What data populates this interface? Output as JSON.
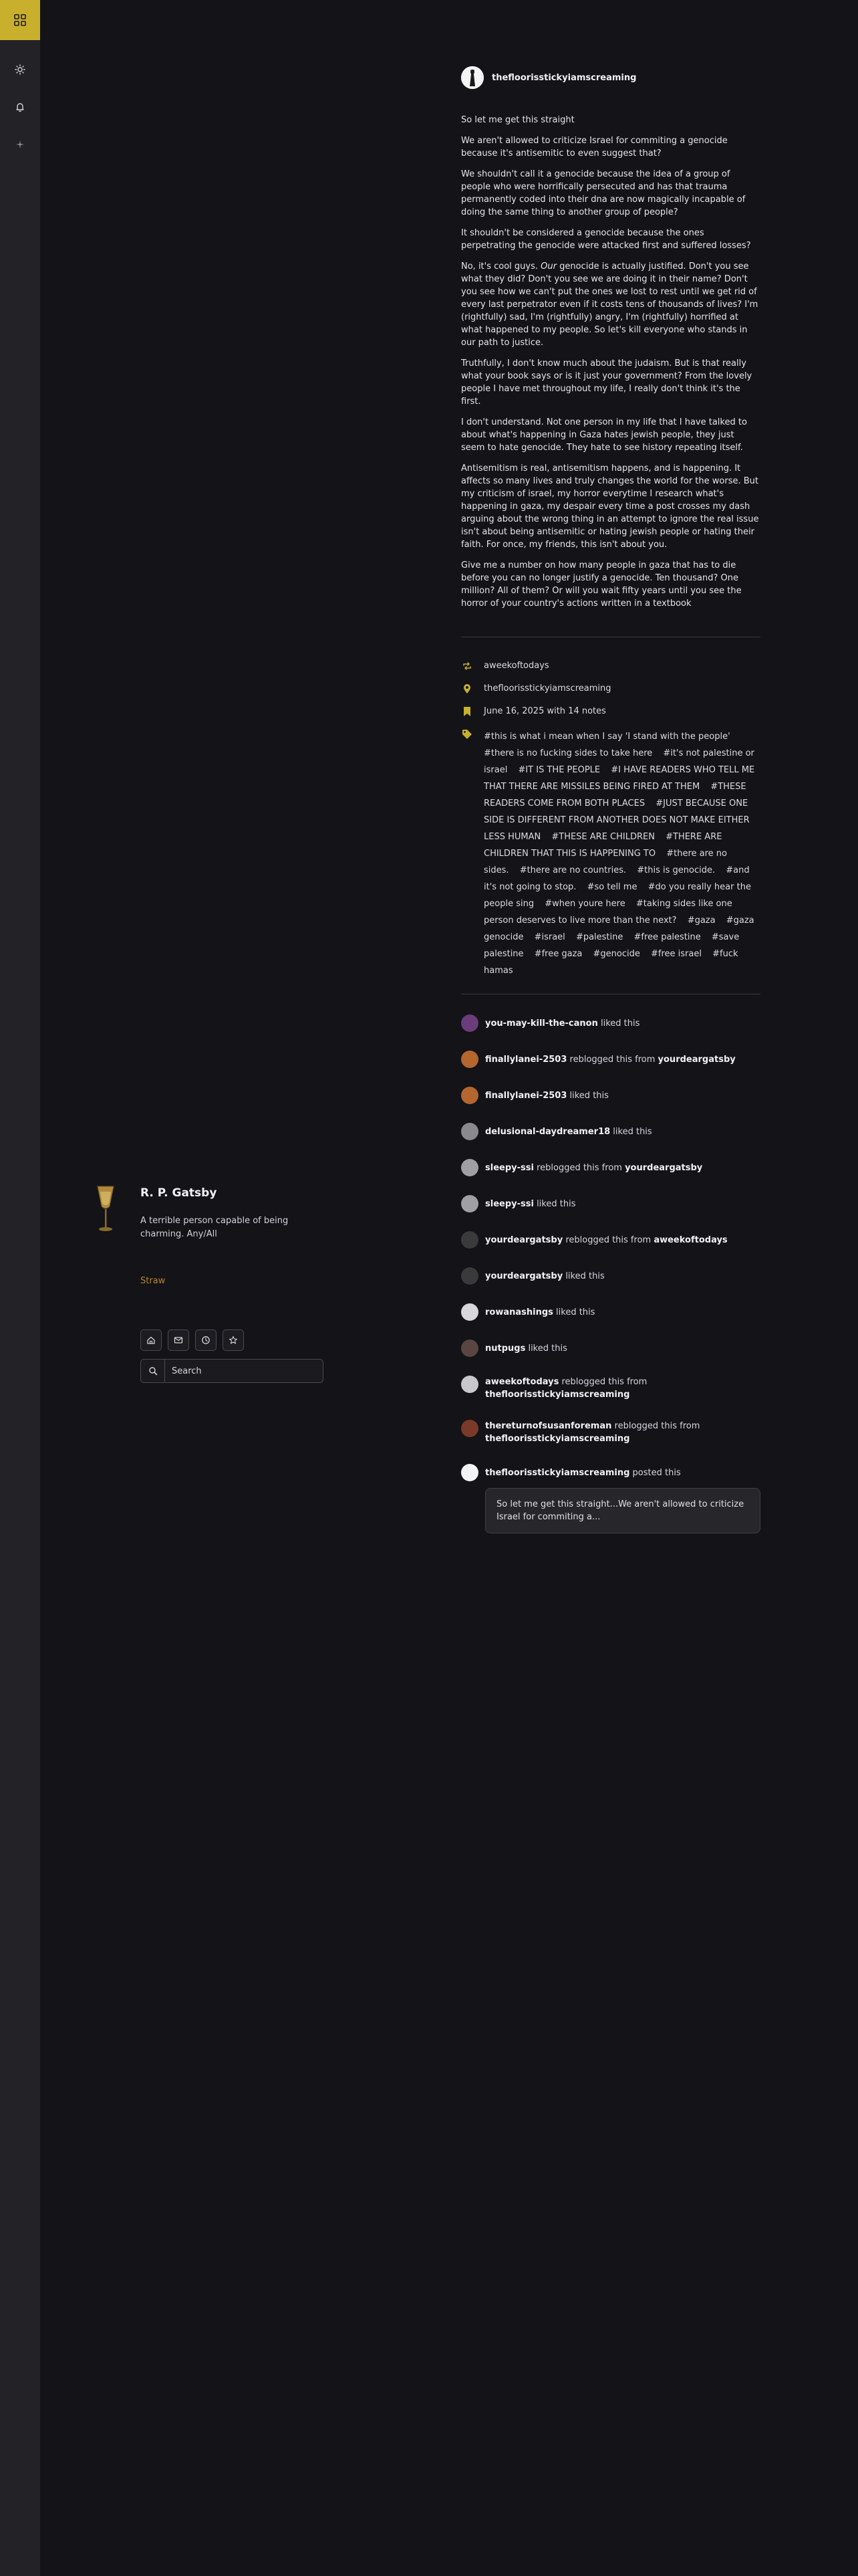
{
  "rail": {
    "items": [
      "grid-icon",
      "sun-icon",
      "bell-icon",
      "sparkle-icon"
    ],
    "accent": "#c9b02c"
  },
  "profile": {
    "name": "R. P. Gatsby",
    "description": "A terrible person capable of being charming. Any/All",
    "link": "Straw",
    "icons": [
      "home-icon",
      "mail-icon",
      "clock-icon",
      "star-icon"
    ],
    "search_placeholder": "Search"
  },
  "post": {
    "author": "thefloorisstickyiamscreaming",
    "paragraphs": [
      "So let me get this straight",
      "We aren't allowed to criticize Israel for commiting a genocide because it's antisemitic to even suggest that?",
      "We shouldn't call it a genocide because the idea of a group of people who were horrifically persecuted and has that trauma permanently coded into their dna are now magically incapable of doing the same thing to another group of people?",
      "It shouldn't be considered a genocide because the ones perpetrating the genocide were attacked first and suffered losses?",
      "No, it's cool guys. |Our| genocide is actually justified. Don't you see what they did? Don't you see we are doing it in their name? Don't you see how we can't put the ones we lost to rest until we get rid of every last perpetrator even if it costs tens of thousands of lives? I'm (rightfully) sad, I'm (rightfully) angry, I'm (rightfully) horrified at what happened to my people. So let's kill everyone who stands in our path to justice.",
      "Truthfully, I don't know much about the judaism. But is that really what your book says or is it just your government? From the lovely people I have met throughout my life, I really don't think it's the first.",
      "I don't understand. Not one person in my life that I have talked to about what's happening in Gaza hates jewish people, they just seem to hate genocide. They hate to see history repeating itself.",
      "Antisemitism is real, antisemitism happens, and is happening. It affects so many lives and truly changes the world for the worse. But my criticism of israel, my horror everytime I research what's happening in gaza, my despair every time a post crosses my dash arguing about the wrong thing in an attempt to ignore the real issue isn't about being antisemitic or hating jewish people or hating their faith. For once, my friends, this isn't about you.",
      "Give me a number on how many people in gaza that has to die before you can no longer justify a genocide. Ten thousand? One million? All of them? Or will you wait fifty years until you see the horror of your country's actions written in a textbook"
    ],
    "meta": {
      "reblogged_from": "aweekoftodays",
      "source": "thefloorisstickyiamscreaming",
      "date_notes": "June 16, 2025 with 14 notes"
    },
    "tags": [
      "#this is what i mean when I say 'I stand with the people'",
      "#there is no fucking sides to take here",
      "#it's not palestine or israel",
      "#IT IS THE PEOPLE",
      "#I HAVE READERS WHO TELL ME THAT THERE ARE MISSILES BEING FIRED AT THEM",
      "#THESE READERS COME FROM BOTH PLACES",
      "#JUST BECAUSE ONE SIDE IS DIFFERENT FROM ANOTHER DOES NOT MAKE EITHER LESS HUMAN",
      "#THESE ARE CHILDREN",
      "#THERE ARE CHILDREN THAT THIS IS HAPPENING TO",
      "#there are no sides.",
      "#there are no countries.",
      "#this is genocide.",
      "#and it's not going to stop.",
      "#so tell me",
      "#do you really hear the people sing",
      "#when youre here",
      "#taking sides like one person deserves to live more than the next?",
      "#gaza",
      "#gaza genocide",
      "#israel",
      "#palestine",
      "#free palestine",
      "#save palestine",
      "#free gaza",
      "#genocide",
      "#free israel",
      "#fuck hamas"
    ]
  },
  "notes": [
    {
      "user": "you-may-kill-the-canon",
      "action": "liked this",
      "from": "",
      "avatar_color": "#6a3d7a"
    },
    {
      "user": "finallylanei-2503",
      "action": "reblogged this from",
      "from": "yourdeargatsby",
      "avatar_color": "#b4662e"
    },
    {
      "user": "finallylanei-2503",
      "action": "liked this",
      "from": "",
      "avatar_color": "#b4662e"
    },
    {
      "user": "delusional-daydreamer18",
      "action": "liked this",
      "from": "",
      "avatar_color": "#8a8a8e"
    },
    {
      "user": "sleepy-ssi",
      "action": "reblogged this from",
      "from": "yourdeargatsby",
      "avatar_color": "#a0a0a4"
    },
    {
      "user": "sleepy-ssi",
      "action": "liked this",
      "from": "",
      "avatar_color": "#a0a0a4"
    },
    {
      "user": "yourdeargatsby",
      "action": "reblogged this from",
      "from": "aweekoftodays",
      "avatar_color": "#3a3a3a"
    },
    {
      "user": "yourdeargatsby",
      "action": "liked this",
      "from": "",
      "avatar_color": "#3a3a3a"
    },
    {
      "user": "rowanashings",
      "action": "liked this",
      "from": "",
      "avatar_color": "#d8d8dc"
    },
    {
      "user": "nutpugs",
      "action": "liked this",
      "from": "",
      "avatar_color": "#5a4640"
    },
    {
      "user": "aweekoftodays",
      "action": "reblogged this from",
      "from": "thefloorisstickyiamscreaming",
      "avatar_color": "#c8c8cc"
    },
    {
      "user": "thereturnofsusanforeman",
      "action": "reblogged this from",
      "from": "thefloorisstickyiamscreaming",
      "avatar_color": "#7a3a2a"
    },
    {
      "user": "thefloorisstickyiamscreaming",
      "action": "posted this",
      "from": "",
      "avatar_color": "#f4f4f4"
    }
  ],
  "posted_quote": "So let me get this straight...We aren't allowed to criticize Israel for commiting a...",
  "colors": {
    "background": "#131318",
    "rail": "#222227",
    "accent": "#c9b02c",
    "link": "#b8862e"
  }
}
